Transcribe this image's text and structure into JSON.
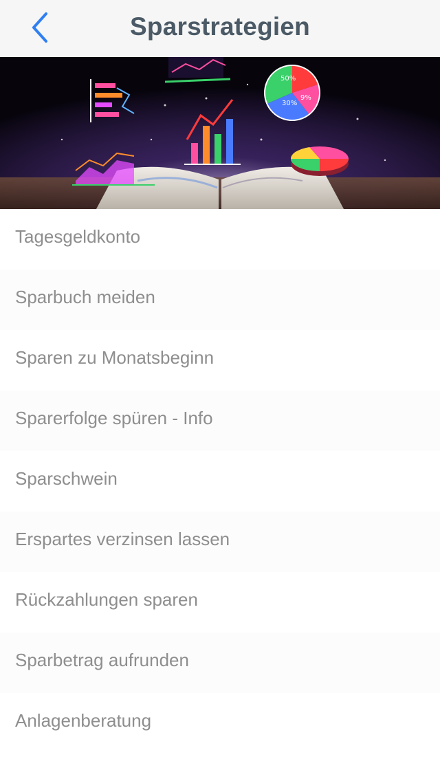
{
  "nav": {
    "title": "Sparstrategien",
    "back_icon": "chevron-left-icon",
    "accent_color": "#2f7ff2"
  },
  "hero": {
    "chart_labels": [
      "50%",
      "30%",
      "9%"
    ]
  },
  "menu": {
    "items": [
      {
        "label": "Tagesgeldkonto"
      },
      {
        "label": "Sparbuch meiden"
      },
      {
        "label": "Sparen zu Monatsbeginn"
      },
      {
        "label": "Sparerfolge spüren - Info"
      },
      {
        "label": "Sparschwein"
      },
      {
        "label": "Erspartes verzinsen lassen"
      },
      {
        "label": "Rückzahlungen sparen"
      },
      {
        "label": "Sparbetrag aufrunden"
      },
      {
        "label": "Anlagenberatung"
      }
    ]
  }
}
